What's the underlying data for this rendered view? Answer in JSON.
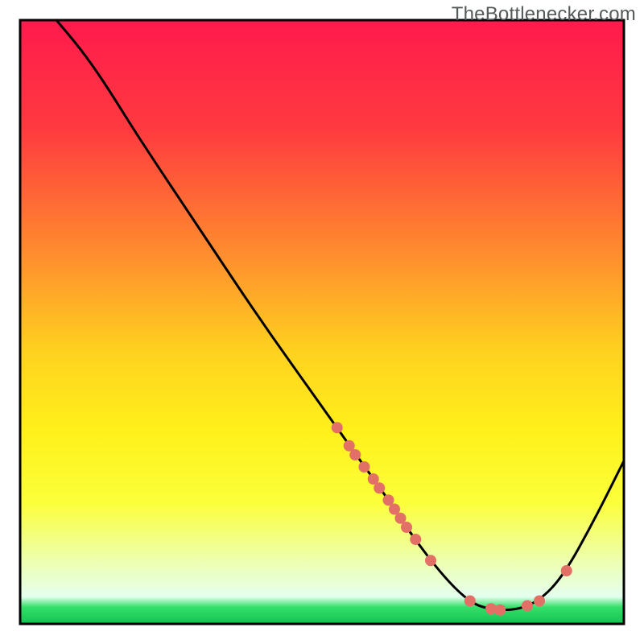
{
  "watermark": "TheBottlenecker.com",
  "chart_data": {
    "type": "line",
    "title": "",
    "xlabel": "",
    "ylabel": "",
    "xlim": [
      0,
      100
    ],
    "ylim": [
      0,
      100
    ],
    "gradient_stops": [
      {
        "offset": 0.0,
        "color": "#ff1a4d"
      },
      {
        "offset": 0.18,
        "color": "#ff3a3f"
      },
      {
        "offset": 0.38,
        "color": "#ff8a2e"
      },
      {
        "offset": 0.55,
        "color": "#ffd21f"
      },
      {
        "offset": 0.68,
        "color": "#fff01a"
      },
      {
        "offset": 0.8,
        "color": "#fbff3a"
      },
      {
        "offset": 0.9,
        "color": "#ecffb4"
      },
      {
        "offset": 0.955,
        "color": "#e5ffef"
      },
      {
        "offset": 0.972,
        "color": "#35e06a"
      },
      {
        "offset": 1.0,
        "color": "#12c24f"
      }
    ],
    "curve": [
      {
        "x": 6.0,
        "y": 100.0
      },
      {
        "x": 9.0,
        "y": 96.5
      },
      {
        "x": 12.0,
        "y": 92.5
      },
      {
        "x": 15.0,
        "y": 88.0
      },
      {
        "x": 20.0,
        "y": 80.0
      },
      {
        "x": 30.0,
        "y": 65.0
      },
      {
        "x": 40.0,
        "y": 50.0
      },
      {
        "x": 50.0,
        "y": 36.0
      },
      {
        "x": 56.0,
        "y": 27.5
      },
      {
        "x": 60.0,
        "y": 22.0
      },
      {
        "x": 65.0,
        "y": 14.5
      },
      {
        "x": 70.0,
        "y": 8.0
      },
      {
        "x": 74.0,
        "y": 4.0
      },
      {
        "x": 77.0,
        "y": 2.5
      },
      {
        "x": 82.0,
        "y": 2.2
      },
      {
        "x": 86.0,
        "y": 3.8
      },
      {
        "x": 90.0,
        "y": 8.0
      },
      {
        "x": 95.0,
        "y": 17.0
      },
      {
        "x": 100.0,
        "y": 27.0
      }
    ],
    "markers": [
      {
        "x": 52.5,
        "y": 32.5
      },
      {
        "x": 54.5,
        "y": 29.5
      },
      {
        "x": 55.5,
        "y": 28.0
      },
      {
        "x": 57.0,
        "y": 26.0
      },
      {
        "x": 58.5,
        "y": 24.0
      },
      {
        "x": 59.5,
        "y": 22.5
      },
      {
        "x": 61.0,
        "y": 20.5
      },
      {
        "x": 62.0,
        "y": 19.0
      },
      {
        "x": 63.0,
        "y": 17.5
      },
      {
        "x": 64.0,
        "y": 16.0
      },
      {
        "x": 65.5,
        "y": 14.0
      },
      {
        "x": 68.0,
        "y": 10.5
      },
      {
        "x": 74.5,
        "y": 3.8
      },
      {
        "x": 78.0,
        "y": 2.5
      },
      {
        "x": 79.5,
        "y": 2.3
      },
      {
        "x": 84.0,
        "y": 3.0
      },
      {
        "x": 86.0,
        "y": 3.8
      },
      {
        "x": 90.5,
        "y": 8.8
      }
    ],
    "border_color": "#000000",
    "curve_color": "#000000",
    "marker_color": "#e37066",
    "marker_radius": 7
  }
}
